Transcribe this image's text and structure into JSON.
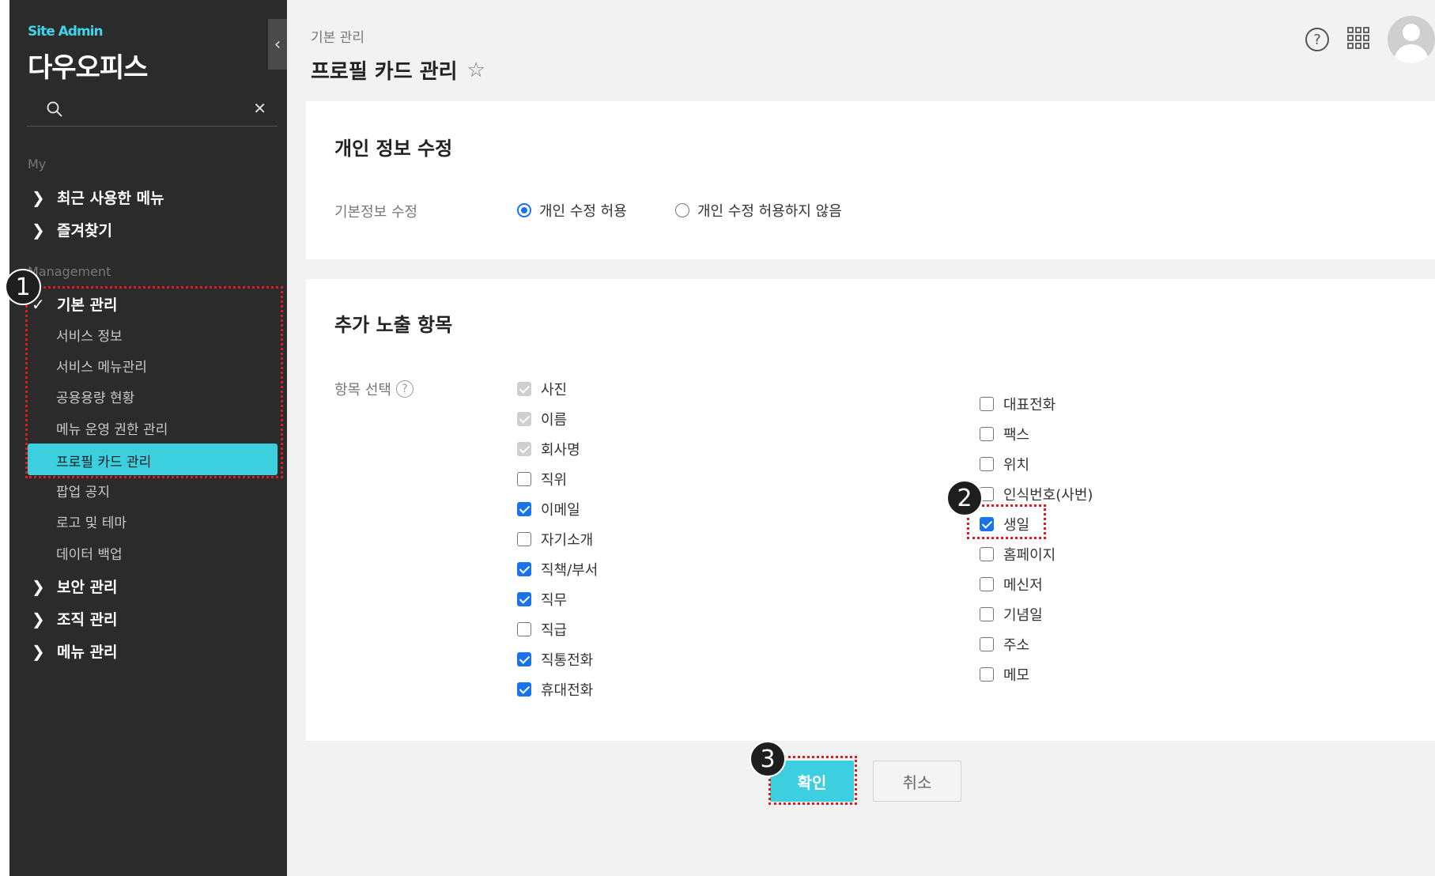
{
  "sidebar": {
    "site_label": "Site Admin",
    "company": "다우오피스",
    "search_placeholder": "",
    "collapse_icon": "‹",
    "section_my": "My",
    "recent_menu": "최근 사용한 메뉴",
    "favorites": "즐겨찾기",
    "section_management": "Management",
    "groups": {
      "basic": "기본 관리",
      "security": "보안 관리",
      "org": "조직 관리",
      "menu": "메뉴 관리"
    },
    "basic_items": [
      "서비스 정보",
      "서비스 메뉴관리",
      "공용용량 현황",
      "메뉴 운영 권한 관리",
      "프로필 카드 관리",
      "팝업 공지",
      "로고 및 테마",
      "데이터 백업"
    ]
  },
  "header": {
    "breadcrumb": "기본 관리",
    "title": "프로필 카드 관리",
    "help": "?"
  },
  "personal": {
    "heading": "개인 정보 수정",
    "label": "기본정보 수정",
    "option_allow": "개인 수정 허용",
    "option_deny": "개인 수정 허용하지 않음",
    "selected": "allow"
  },
  "extra": {
    "heading": "추가 노출 항목",
    "label": "항목 선택",
    "help": "?",
    "left_items": [
      {
        "label": "사진",
        "state": "disabled"
      },
      {
        "label": "이름",
        "state": "disabled"
      },
      {
        "label": "회사명",
        "state": "disabled"
      },
      {
        "label": "직위",
        "state": "off"
      },
      {
        "label": "이메일",
        "state": "on"
      },
      {
        "label": "자기소개",
        "state": "off"
      },
      {
        "label": "직책/부서",
        "state": "on"
      },
      {
        "label": "직무",
        "state": "on"
      },
      {
        "label": "직급",
        "state": "off"
      },
      {
        "label": "직통전화",
        "state": "on"
      },
      {
        "label": "휴대전화",
        "state": "on"
      }
    ],
    "right_items": [
      {
        "label": "대표전화",
        "state": "off"
      },
      {
        "label": "팩스",
        "state": "off"
      },
      {
        "label": "위치",
        "state": "off"
      },
      {
        "label": "인식번호(사번)",
        "state": "off"
      },
      {
        "label": "생일",
        "state": "on"
      },
      {
        "label": "홈페이지",
        "state": "off"
      },
      {
        "label": "메신저",
        "state": "off"
      },
      {
        "label": "기념일",
        "state": "off"
      },
      {
        "label": "주소",
        "state": "off"
      },
      {
        "label": "메모",
        "state": "off"
      }
    ]
  },
  "buttons": {
    "confirm": "확인",
    "cancel": "취소"
  },
  "badges": [
    "1",
    "2",
    "3"
  ],
  "colors": {
    "accent": "#3ccfe0",
    "checkbox": "#1a73e8",
    "highlight": "#e01b1b"
  }
}
